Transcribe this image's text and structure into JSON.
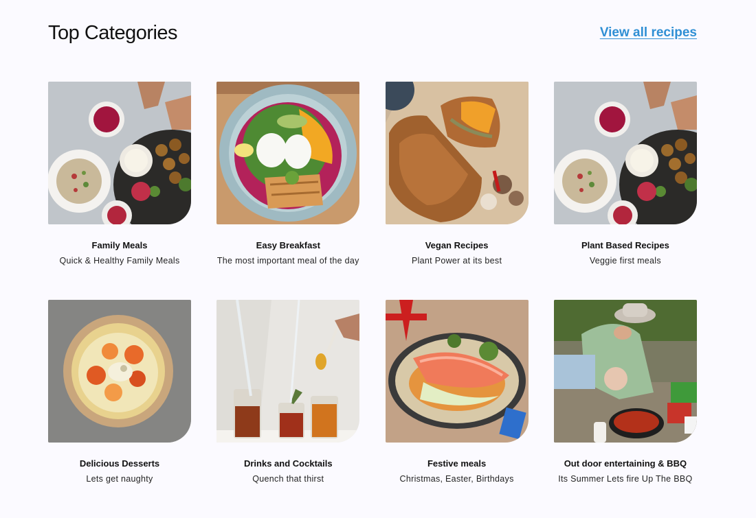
{
  "section": {
    "title": "Top Categories",
    "view_all_label": "View all recipes"
  },
  "categories": [
    {
      "title": "Family Meals",
      "subtitle": "Quick & Healthy Family Meals",
      "image_icon": "mezze-platter-photo"
    },
    {
      "title": "Easy Breakfast",
      "subtitle": "The most important meal of the day",
      "image_icon": "breakfast-bowl-photo"
    },
    {
      "title": "Vegan Recipes",
      "subtitle": "Plant Power at its best",
      "image_icon": "vegan-wellington-photo"
    },
    {
      "title": "Plant Based Recipes",
      "subtitle": "Veggie first meals",
      "image_icon": "mezze-platter-photo"
    },
    {
      "title": "Delicious Desserts",
      "subtitle": "Lets get naughty",
      "image_icon": "fruit-tart-photo"
    },
    {
      "title": "Drinks and Cocktails",
      "subtitle": "Quench that thirst",
      "image_icon": "cocktails-photo"
    },
    {
      "title": "Festive meals",
      "subtitle": "Christmas, Easter, Birthdays",
      "image_icon": "salmon-plate-photo"
    },
    {
      "title": "Out door entertaining & BBQ",
      "subtitle": "Its Summer Lets fire Up The BBQ",
      "image_icon": "outdoor-cooking-photo"
    }
  ],
  "colors": {
    "link": "#2f8fd4",
    "background": "#fbfaff",
    "text": "#111111"
  }
}
